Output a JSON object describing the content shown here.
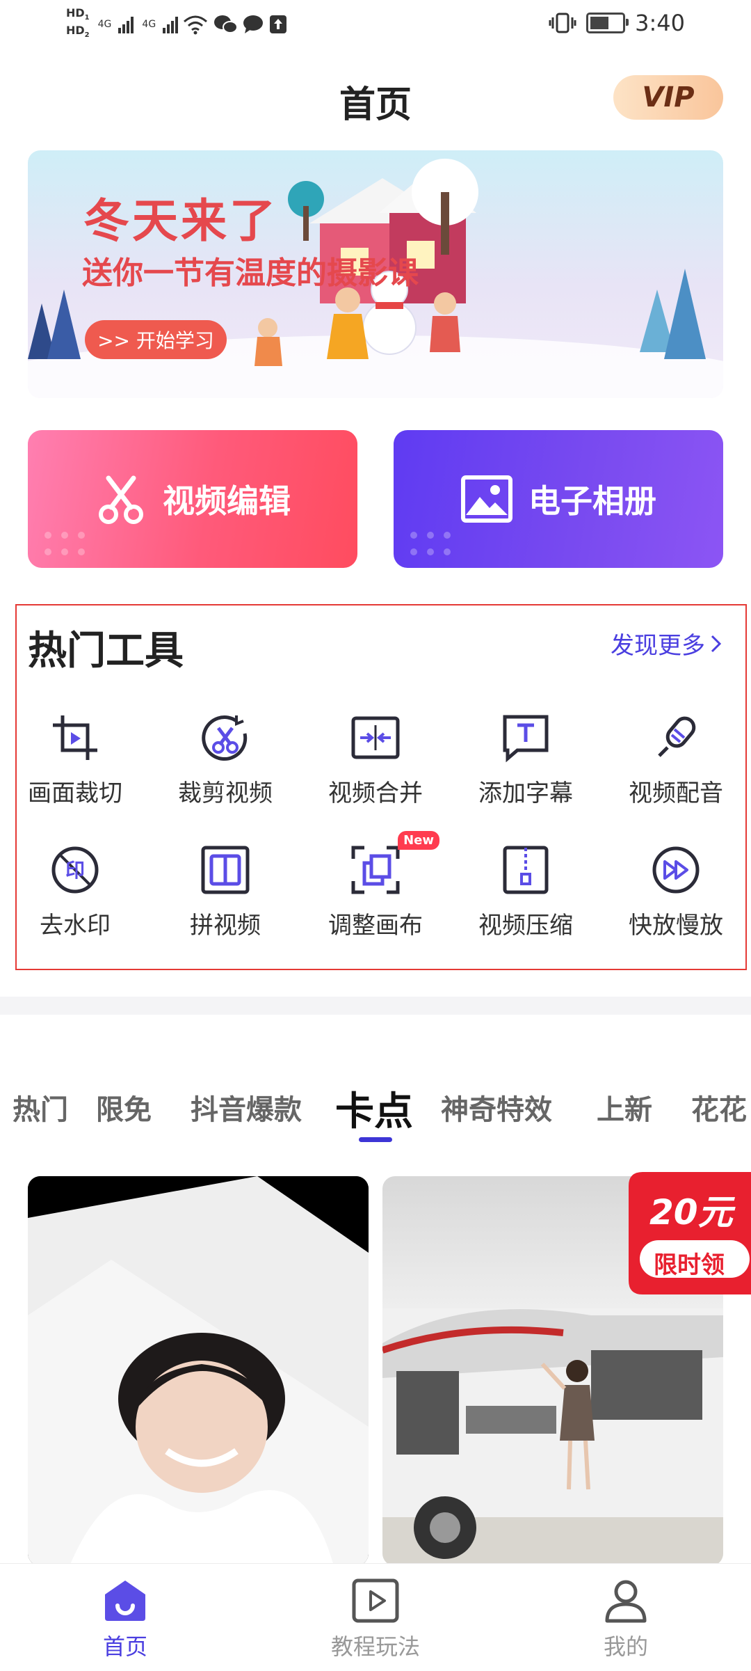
{
  "status_bar": {
    "hd1": "HD",
    "hd1_sub": "1",
    "hd2": "HD",
    "hd2_sub": "2",
    "net1": "4G",
    "net2": "4G",
    "time": "3:40"
  },
  "header": {
    "title": "首页",
    "vip": "VIP"
  },
  "banner": {
    "title": "冬天来了",
    "subtitle": "送你一节有温度的摄影课",
    "button": ">> 开始学习"
  },
  "actions": {
    "video_edit": "视频编辑",
    "photo_album": "电子相册"
  },
  "hot_tools": {
    "title": "热门工具",
    "more": "发现更多",
    "new_badge": "New",
    "items": [
      {
        "label": "画面裁切",
        "icon": "crop-icon"
      },
      {
        "label": "裁剪视频",
        "icon": "scissors-circle-icon"
      },
      {
        "label": "视频合并",
        "icon": "merge-icon"
      },
      {
        "label": "添加字幕",
        "icon": "subtitle-icon"
      },
      {
        "label": "视频配音",
        "icon": "mic-icon"
      },
      {
        "label": "去水印",
        "icon": "watermark-remove-icon"
      },
      {
        "label": "拼视频",
        "icon": "split-screen-icon"
      },
      {
        "label": "调整画布",
        "icon": "canvas-icon"
      },
      {
        "label": "视频压缩",
        "icon": "zip-icon"
      },
      {
        "label": "快放慢放",
        "icon": "speed-icon"
      }
    ]
  },
  "categories": {
    "items": [
      "热门",
      "限免",
      "抖音爆款",
      "卡点",
      "神奇特效",
      "上新",
      "花花"
    ],
    "active": "卡点"
  },
  "promo": {
    "amount": "20元",
    "label": "限时领"
  },
  "bottom_nav": {
    "items": [
      {
        "label": "首页",
        "icon": "home-icon"
      },
      {
        "label": "教程玩法",
        "icon": "tutorial-play-icon"
      },
      {
        "label": "我的",
        "icon": "profile-icon"
      }
    ]
  },
  "colors": {
    "accent": "#4a3ee0",
    "video_edit_bg": "#ff5a7a",
    "photo_album_bg": "#6b42f2",
    "banner_text": "#e5484d",
    "highlight_border": "#e53935"
  }
}
